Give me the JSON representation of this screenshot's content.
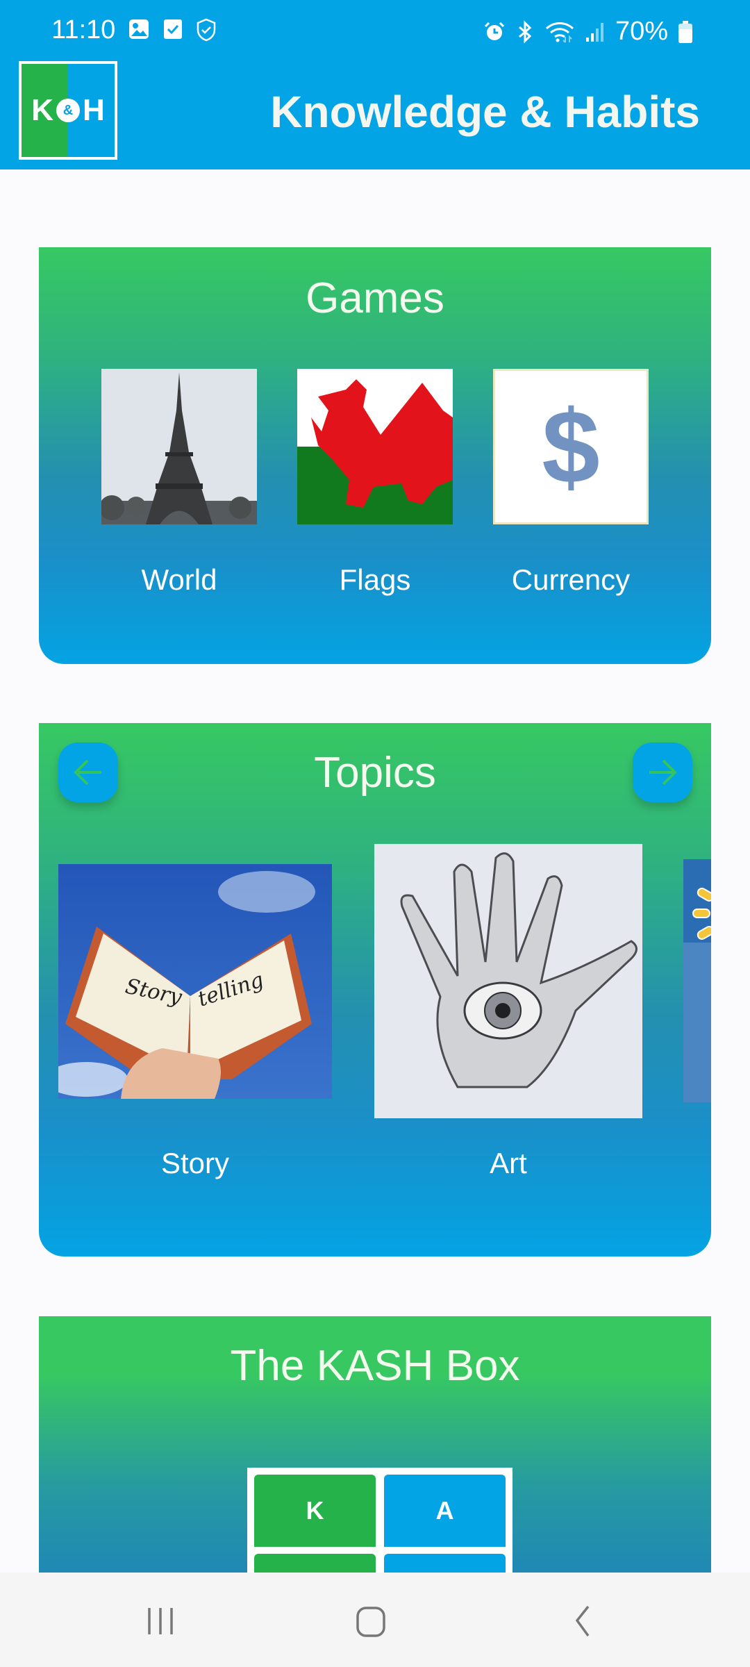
{
  "status_bar": {
    "time": "11:10",
    "left_icons": [
      "gallery-icon",
      "checkbox-icon",
      "shield-check-icon"
    ],
    "right_icons": [
      "alarm-icon",
      "bluetooth-icon",
      "wifi-icon",
      "signal-icon"
    ],
    "battery_percent": "70%"
  },
  "app_bar": {
    "logo": {
      "left_letter": "K",
      "amp": "&",
      "right_letter": "H"
    },
    "title": "Knowledge & Habits"
  },
  "games": {
    "title": "Games",
    "items": [
      {
        "label": "World",
        "image": "eiffel-tower-image"
      },
      {
        "label": "Flags",
        "image": "welsh-flag-image"
      },
      {
        "label": "Currency",
        "image": "dollar-sign-image",
        "symbol": "$"
      }
    ]
  },
  "topics": {
    "title": "Topics",
    "prev_icon": "arrow-left-icon",
    "next_icon": "arrow-right-icon",
    "items": [
      {
        "label": "Story",
        "image": "storytelling-book-image",
        "book_text_left": "Story",
        "book_text_right": "telling"
      },
      {
        "label": "Art",
        "image": "hand-eye-drawing-image"
      },
      {
        "label": "",
        "image": "partial-topic-image"
      }
    ]
  },
  "kash_box": {
    "title": "The KASH Box",
    "cells": [
      {
        "letter": "K",
        "color": "#26b24b"
      },
      {
        "letter": "A",
        "color": "#03a4e5"
      },
      {
        "letter": "",
        "color": "#26b24b"
      },
      {
        "letter": "",
        "color": "#03a4e5"
      }
    ]
  },
  "nav_bar": {
    "recents": "recents-icon",
    "home": "home-icon",
    "back": "back-icon"
  },
  "colors": {
    "primary_blue": "#03a4e5",
    "primary_green": "#26b24b",
    "card_green": "#37c862"
  }
}
